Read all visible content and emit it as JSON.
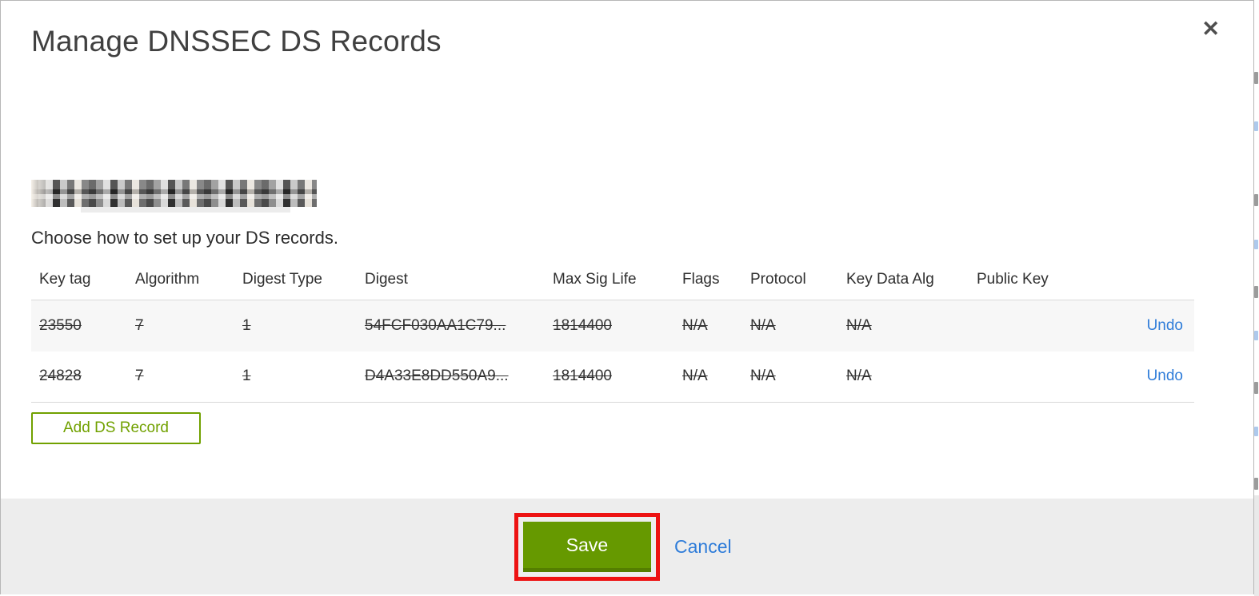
{
  "modal": {
    "title": "Manage DNSSEC DS Records",
    "instruction": "Choose how to set up your DS records."
  },
  "icons": {
    "close": "✕"
  },
  "table": {
    "headers": [
      "Key tag",
      "Algorithm",
      "Digest Type",
      "Digest",
      "Max Sig Life",
      "Flags",
      "Protocol",
      "Key Data Alg",
      "Public Key",
      ""
    ],
    "rows": [
      {
        "key_tag": "23550",
        "algorithm": "7",
        "digest_type": "1",
        "digest": "54FCF030AA1C79...",
        "max_sig_life": "1814400",
        "flags": "N/A",
        "protocol": "N/A",
        "key_data_alg": "N/A",
        "public_key": "",
        "action": "Undo"
      },
      {
        "key_tag": "24828",
        "algorithm": "7",
        "digest_type": "1",
        "digest": "D4A33E8DD550A9...",
        "max_sig_life": "1814400",
        "flags": "N/A",
        "protocol": "N/A",
        "key_data_alg": "N/A",
        "public_key": "",
        "action": "Undo"
      }
    ]
  },
  "buttons": {
    "add_record": "Add DS Record",
    "save": "Save",
    "cancel": "Cancel"
  },
  "colors": {
    "action_green": "#669900",
    "outline_green": "#71a100",
    "link_blue": "#2e7cd9",
    "highlight_red": "#ed1212",
    "footer_gray": "#ededed"
  }
}
